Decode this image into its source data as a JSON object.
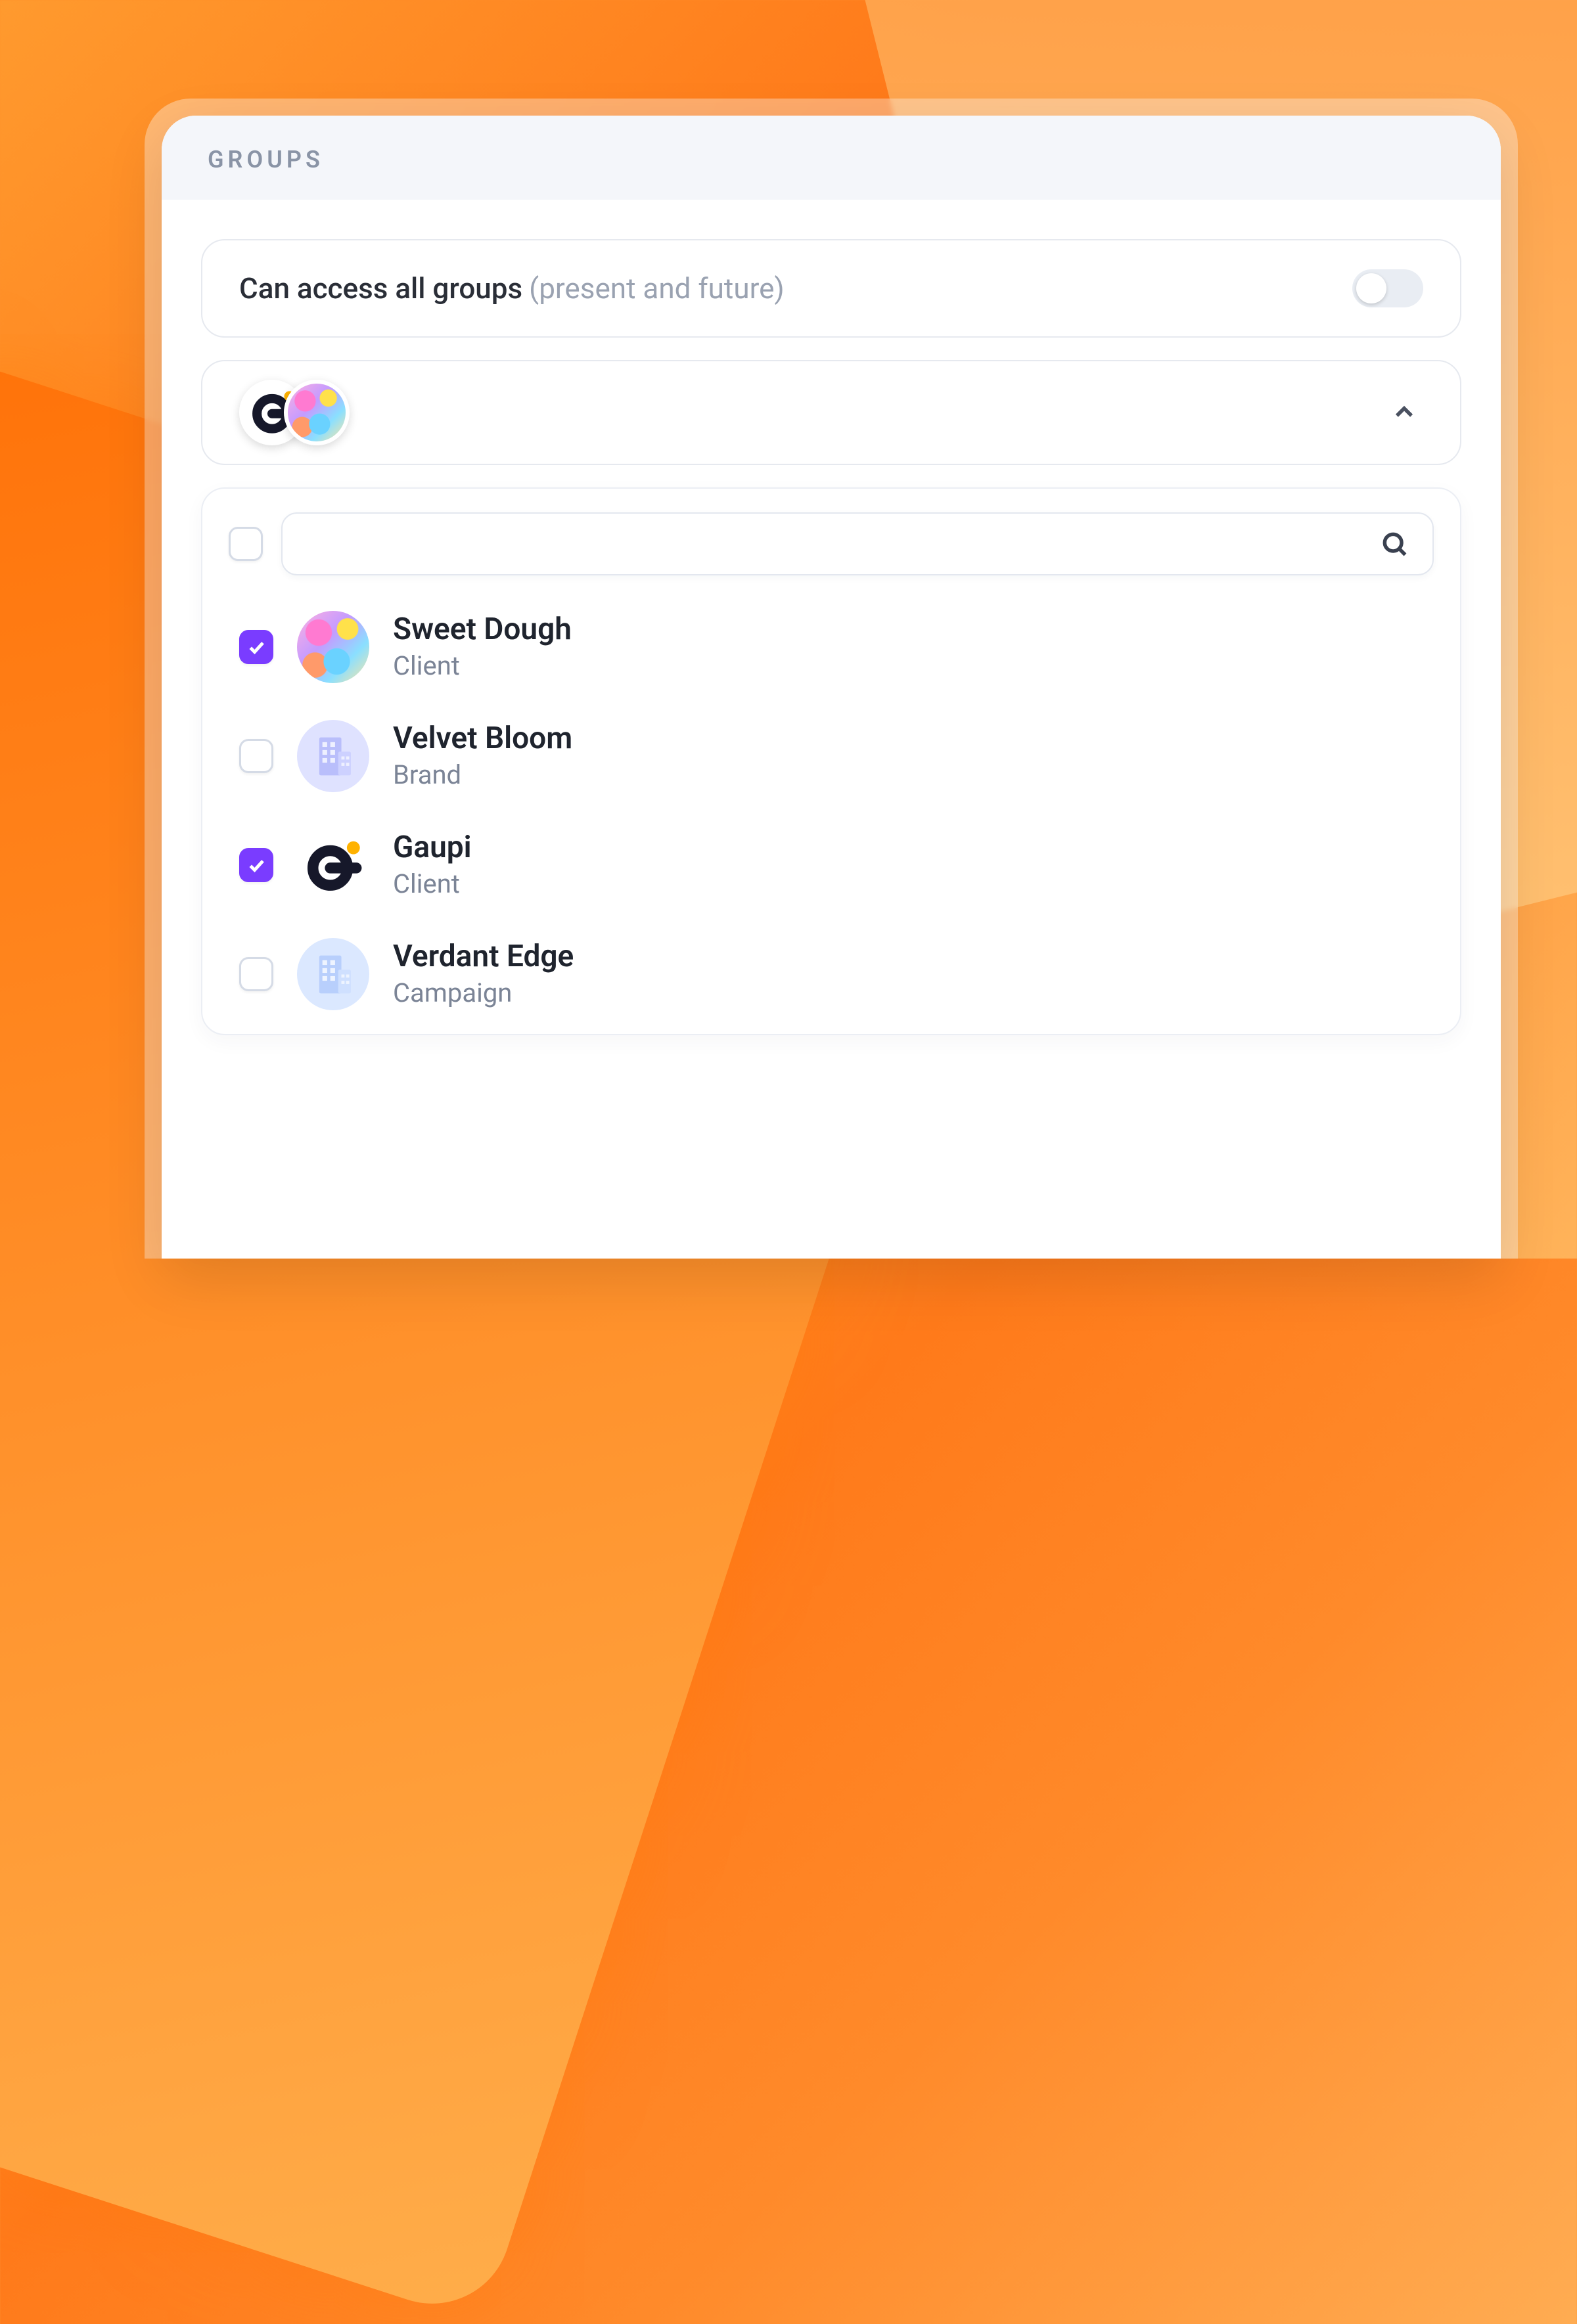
{
  "header": {
    "title": "Groups"
  },
  "access": {
    "title": "Can access all groups",
    "subtitle": "(present and future)",
    "enabled": false
  },
  "dropdown": {
    "expanded": true,
    "selected_avatars": [
      "gaupi",
      "sweet-dough"
    ]
  },
  "search": {
    "placeholder": "",
    "value": ""
  },
  "select_all_checked": false,
  "items": [
    {
      "id": "sweet-dough",
      "name": "Sweet Dough",
      "type": "Client",
      "checked": true,
      "avatar": "sweet"
    },
    {
      "id": "velvet-bloom",
      "name": "Velvet Bloom",
      "type": "Brand",
      "checked": false,
      "avatar": "building-purple"
    },
    {
      "id": "gaupi",
      "name": "Gaupi",
      "type": "Client",
      "checked": true,
      "avatar": "gaupi"
    },
    {
      "id": "verdant-edge",
      "name": "Verdant Edge",
      "type": "Campaign",
      "checked": false,
      "avatar": "building-blue"
    }
  ]
}
